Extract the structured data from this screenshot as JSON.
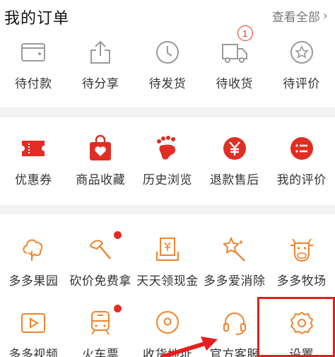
{
  "orders": {
    "title": "我的订单",
    "view_all": "查看全部",
    "items": [
      {
        "label": "待付款",
        "icon": "wallet-icon"
      },
      {
        "label": "待分享",
        "icon": "share-icon"
      },
      {
        "label": "待发货",
        "icon": "clock-icon"
      },
      {
        "label": "待收货",
        "icon": "truck-icon",
        "badge": "1"
      },
      {
        "label": "待评价",
        "icon": "star-bubble-icon"
      }
    ]
  },
  "services": {
    "items": [
      {
        "label": "优惠券",
        "icon": "coupon-icon"
      },
      {
        "label": "商品收藏",
        "icon": "heart-bag-icon"
      },
      {
        "label": "历史浏览",
        "icon": "footprint-icon"
      },
      {
        "label": "退款售后",
        "icon": "yuan-icon"
      },
      {
        "label": "我的评价",
        "icon": "comment-list-icon"
      }
    ]
  },
  "tools": {
    "row1": [
      {
        "label": "多多果园",
        "icon": "tree-icon"
      },
      {
        "label": "砍价免费拿",
        "icon": "axe-icon",
        "dot": true
      },
      {
        "label": "天天领现金",
        "icon": "cash-icon"
      },
      {
        "label": "多多爱消除",
        "icon": "magic-wand-icon"
      },
      {
        "label": "多多牧场",
        "icon": "cow-icon"
      }
    ],
    "row2": [
      {
        "label": "多多视频",
        "icon": "video-icon"
      },
      {
        "label": "火车票",
        "icon": "train-icon",
        "dot": true
      },
      {
        "label": "收货地址",
        "icon": "location-icon"
      },
      {
        "label": "官方客服",
        "icon": "headset-icon"
      },
      {
        "label": "设置",
        "icon": "gear-icon"
      }
    ]
  },
  "colors": {
    "brand_red": "#e02e24",
    "tool_orange": "#f0842c",
    "outline_gray": "#9a9a9a",
    "annotation_red": "#e61e1e"
  }
}
